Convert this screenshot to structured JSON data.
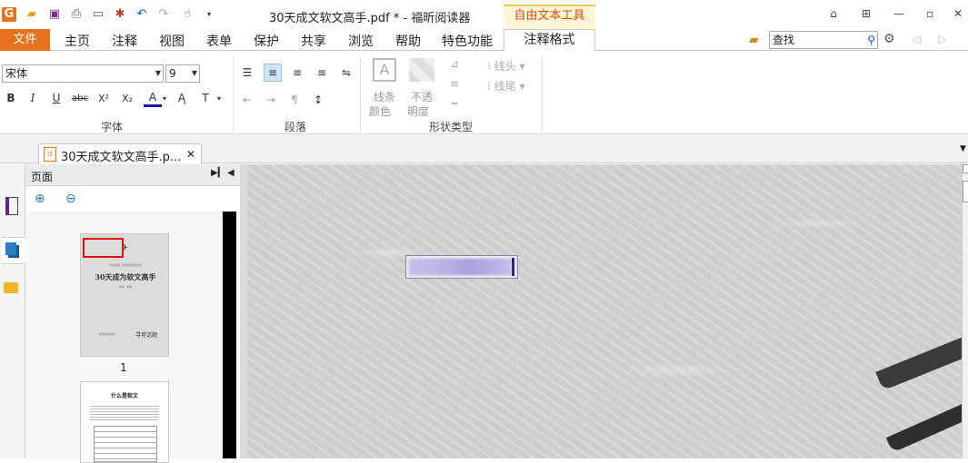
{
  "window": {
    "title": "30天成文软文高手.pdf * - 福昕阅读器",
    "context_group": "自由文本工具"
  },
  "menu": {
    "file": "文件",
    "tabs": [
      "主页",
      "注释",
      "视图",
      "表单",
      "保护",
      "共享",
      "浏览",
      "帮助",
      "特色功能"
    ],
    "active_tab": "注释格式"
  },
  "search": {
    "placeholder": "查找"
  },
  "ribbon": {
    "font": {
      "name": "宋体",
      "size": "9",
      "group_label": "字体"
    },
    "paragraph": {
      "group_label": "段落"
    },
    "shape": {
      "line_color": [
        "线条",
        "颜色"
      ],
      "opacity": [
        "不透",
        "明度"
      ],
      "group_label": "形状类型",
      "line_start": "线头",
      "line_end": "线尾"
    }
  },
  "document_tab": {
    "label": "30天成文软文高手.p..."
  },
  "panel": {
    "title": "页面",
    "page1_number": "1",
    "page1": {
      "subtitle": "写作技能 · 新媒体运营系列",
      "title": "30天成为软文高手",
      "author": "作者 · 编著",
      "publisher": "新媒体出版社",
      "brand": "寻常话题"
    },
    "page2": {
      "title": "什么是软文"
    }
  },
  "colors": {
    "accent": "#e8711e",
    "context": "#f0c94a",
    "font_color_bar": "#1a1aa8"
  }
}
